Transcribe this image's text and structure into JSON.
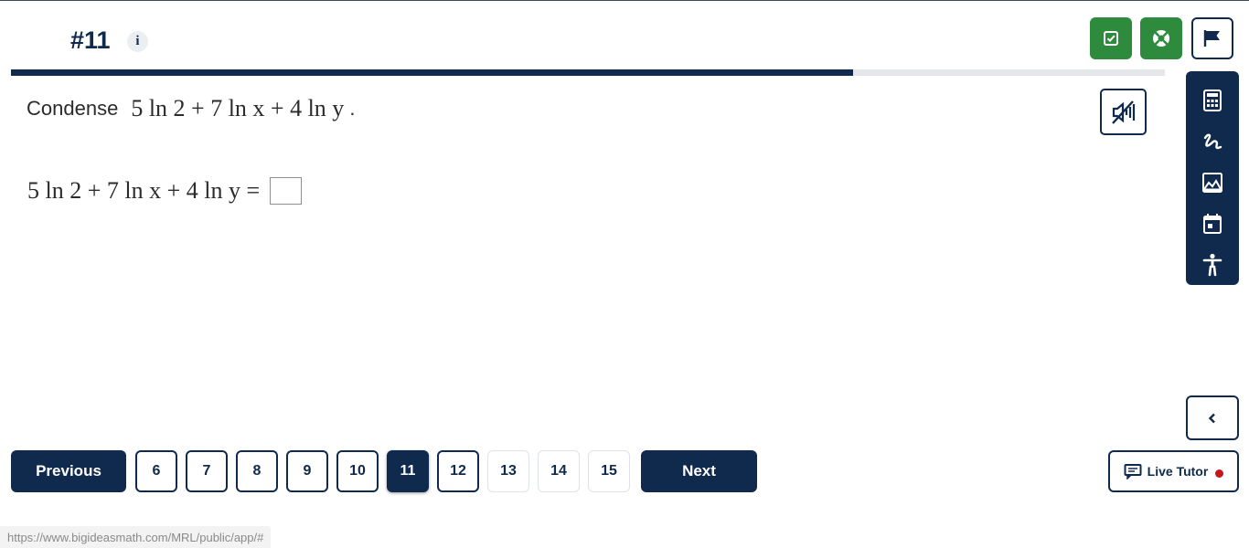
{
  "header": {
    "question_title": "#11",
    "info_icon_glyph": "i"
  },
  "progress": {
    "fraction": 0.73
  },
  "question": {
    "prompt_word": "Condense",
    "expression": "5 ln 2 + 7 ln x +  4 ln y",
    "period": ".",
    "answer_lhs": "5 ln 2 + 7 ln x + 4 ln y =",
    "answer_value": ""
  },
  "toolbar": {
    "icons": [
      "calculator-icon",
      "scribble-icon",
      "image-icon",
      "calendar-icon",
      "accessibility-icon"
    ]
  },
  "pagination": {
    "previous_label": "Previous",
    "next_label": "Next",
    "pages": [
      {
        "label": "6",
        "state": "visited"
      },
      {
        "label": "7",
        "state": "visited"
      },
      {
        "label": "8",
        "state": "visited"
      },
      {
        "label": "9",
        "state": "visited"
      },
      {
        "label": "10",
        "state": "visited"
      },
      {
        "label": "11",
        "state": "current"
      },
      {
        "label": "12",
        "state": "visited"
      },
      {
        "label": "13",
        "state": "unvisited"
      },
      {
        "label": "14",
        "state": "unvisited"
      },
      {
        "label": "15",
        "state": "unvisited"
      }
    ]
  },
  "live_tutor": {
    "label": "Live Tutor",
    "status_color": "#c8161d"
  },
  "status_bar": {
    "url": "https://www.bigideasmath.com/MRL/public/app/#"
  },
  "colors": {
    "navy": "#0f2a4d",
    "green": "#2e8b3e"
  }
}
